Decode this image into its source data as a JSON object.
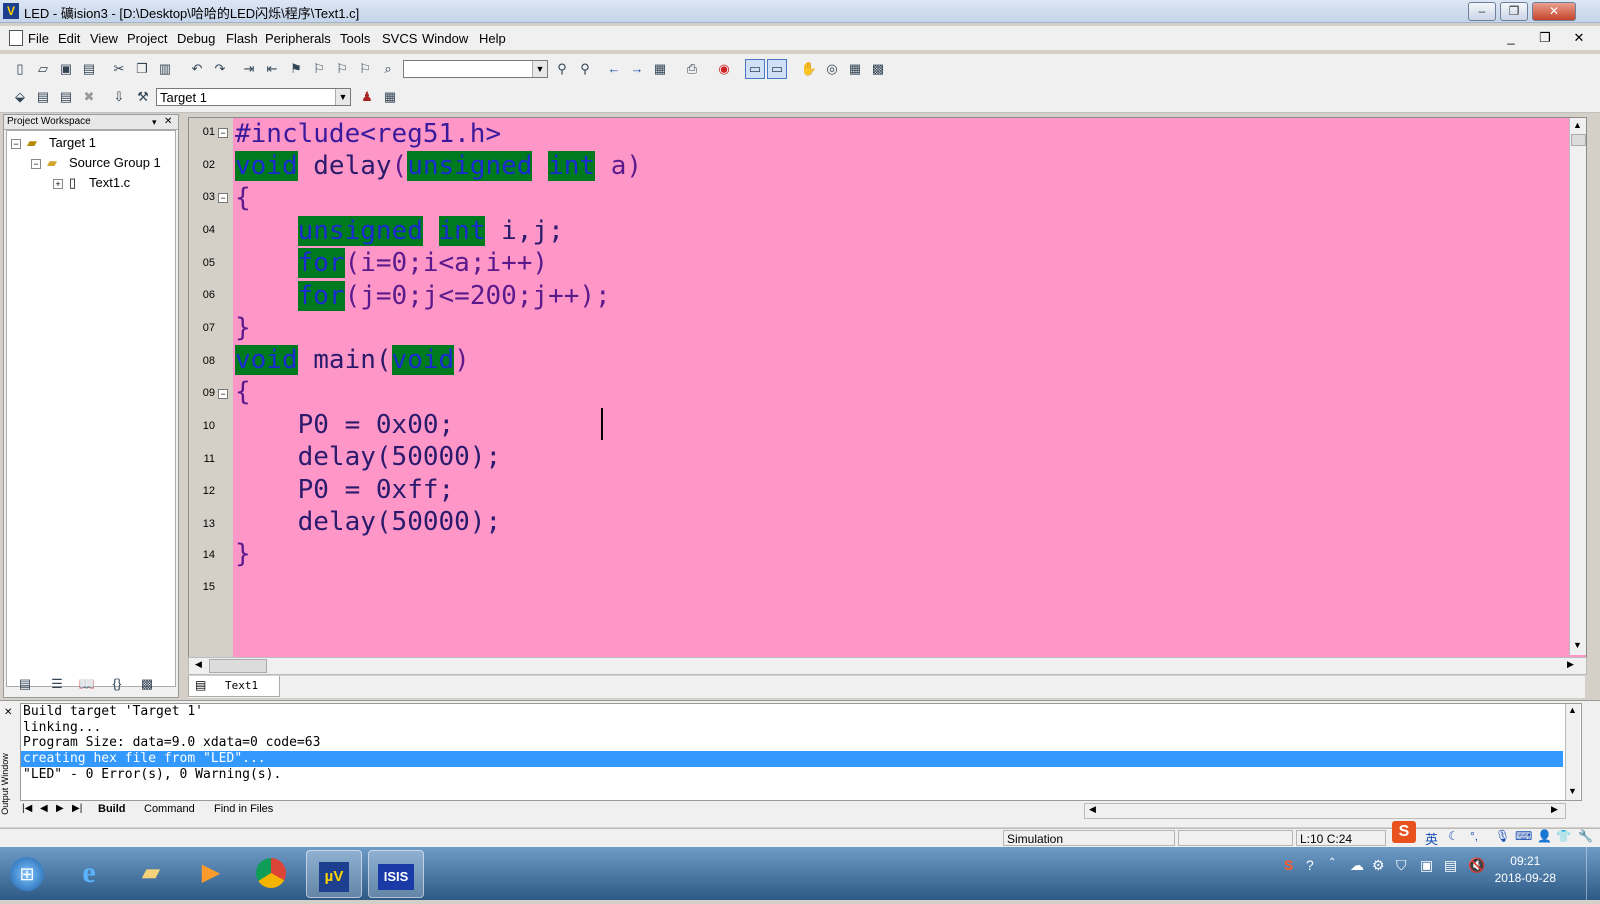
{
  "window": {
    "title": "LED  - 礦ision3 - [D:\\Desktop\\哈哈的LED闪烁\\程序\\Text1.c]",
    "logo_text": "V",
    "min_glyph": "–",
    "max_glyph": "❐",
    "close_glyph": "✕"
  },
  "menu": [
    "File",
    "Edit",
    "View",
    "Project",
    "Debug",
    "Flash",
    "Peripherals",
    "Tools",
    "SVCS",
    "Window",
    "Help"
  ],
  "mdi_controls": [
    "_",
    "❐",
    "✕"
  ],
  "toolbar": {
    "find_combo_value": "",
    "target_combo_value": "Target 1",
    "icons1": [
      "new-file",
      "open",
      "save",
      "save-all",
      "cut",
      "copy",
      "paste",
      "undo",
      "redo",
      "indent",
      "outdent",
      "bookmark",
      "prev-bookmark",
      "next-bookmark",
      "clear-bookmarks",
      "find-in-files",
      "find",
      "find-next",
      "back",
      "forward",
      "bookmark-list",
      "print",
      "debug-session",
      "source-window",
      "disasm-window",
      "hand",
      "watch",
      "memory",
      "serial"
    ],
    "icons2": [
      "translate",
      "build",
      "rebuild",
      "stop-build",
      "download",
      "options",
      "target-select",
      "manage-components",
      "batch-build"
    ]
  },
  "workspace": {
    "header": "Project Workspace",
    "tree": [
      {
        "label": "Target 1",
        "level": 0,
        "expander": "−"
      },
      {
        "label": "Source Group 1",
        "level": 1,
        "expander": "−"
      },
      {
        "label": "Text1.c",
        "level": 2,
        "expander": "+"
      }
    ],
    "tabs": [
      "files-tab",
      "regs-tab",
      "books-tab",
      "functions-tab",
      "templates-tab"
    ]
  },
  "editor": {
    "file_tab": "Text1",
    "lines": [
      {
        "num": "01",
        "fold": "−"
      },
      {
        "num": "02"
      },
      {
        "num": "03",
        "fold": "−"
      },
      {
        "num": "04"
      },
      {
        "num": "05"
      },
      {
        "num": "06"
      },
      {
        "num": "07"
      },
      {
        "num": "08"
      },
      {
        "num": "09",
        "fold": "−"
      },
      {
        "num": "10"
      },
      {
        "num": "11"
      },
      {
        "num": "12"
      },
      {
        "num": "13"
      },
      {
        "num": "14"
      },
      {
        "num": "15"
      }
    ],
    "code": {
      "l1": "#include<reg51.h>",
      "l2_kw1": "void",
      "l2_name": " delay",
      "l2_open": "(",
      "l2_kw2": "unsigned",
      "l2_kw3": "int",
      "l2_rest": " a)",
      "l3": "{",
      "l4_kw1": "unsigned",
      "l4_kw2": "int",
      "l4_rest": " i,j;",
      "l5_kw": "for",
      "l5_rest": "(i=0;i<a;i++)",
      "l6_kw": "for",
      "l6_rest": "(j=0;j<=200;j++);",
      "l7": "}",
      "l8_kw1": "void",
      "l8_name": " main(",
      "l8_kw2": "void",
      "l8_close": ")",
      "l9": "{",
      "l10": "P0 = 0x00;",
      "l11": "delay(50000);",
      "l12": "P0 = 0xff;",
      "l13": "delay(50000);",
      "l14": "}",
      "l15": ""
    }
  },
  "output": {
    "side_label": "Output Window",
    "lines": [
      "Build target 'Target 1'",
      "linking...",
      "Program Size: data=9.0 xdata=0 code=63",
      "creating hex file from \"LED\"...",
      "\"LED\" - 0 Error(s), 0 Warning(s)."
    ],
    "selected_index": 3,
    "tabs": [
      "Build",
      "Command",
      "Find in Files"
    ]
  },
  "status": {
    "mode": "Simulation",
    "position": "L:10 C:24"
  },
  "taskbar": {
    "apps": [
      "start",
      "internet-explorer",
      "file-explorer",
      "media-player",
      "chrome",
      "keil-uvision",
      "isis"
    ],
    "isis_label": "ISIS",
    "uv_label": "µV",
    "ime": "英",
    "time": "09:21",
    "date": "2018-09-28"
  }
}
